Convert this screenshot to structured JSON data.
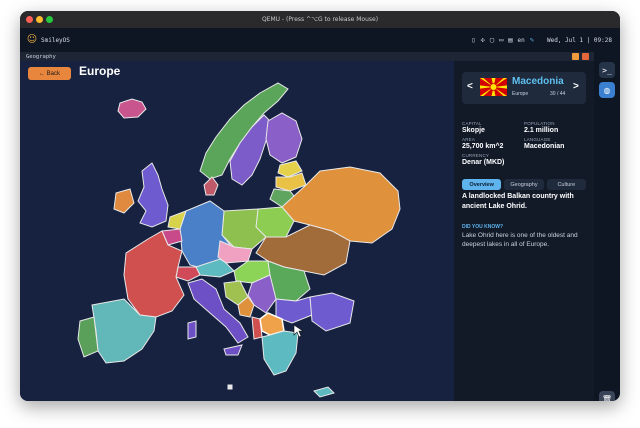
{
  "qemu": {
    "title": "QEMU - (Press ^⌥G to release Mouse)"
  },
  "os": {
    "name": "SmileyOS",
    "lang": "en",
    "clock": "Wed, Jul 1 | 09:28"
  },
  "app": {
    "title": "Geography"
  },
  "map": {
    "back_label": "← Back",
    "region_title": "Europe"
  },
  "country": {
    "name": "Macedonia",
    "region": "Europe",
    "counter": "30 / 44",
    "prev": "<",
    "next": ">",
    "facts": {
      "capital_label": "CAPITAL",
      "capital": "Skopje",
      "population_label": "POPULATION",
      "population": "2.1 million",
      "area_label": "AREA",
      "area": "25,700 km^2",
      "language_label": "LANGUAGE",
      "language": "Macedonian",
      "currency_label": "CURRENCY",
      "currency": "Denar (MKD)"
    }
  },
  "tabs": [
    "Overview",
    "Geography",
    "Culture"
  ],
  "overview": "A landlocked Balkan country with ancient Lake Ohrid.",
  "did_you_know": {
    "label": "DID YOU KNOW?",
    "text": "Lake Ohrid here is one of the oldest and deepest lakes in all of Europe."
  },
  "colors": {
    "accent": "#5fb4ee",
    "button": "#e8863d",
    "selected_country": "#f0a24a"
  }
}
